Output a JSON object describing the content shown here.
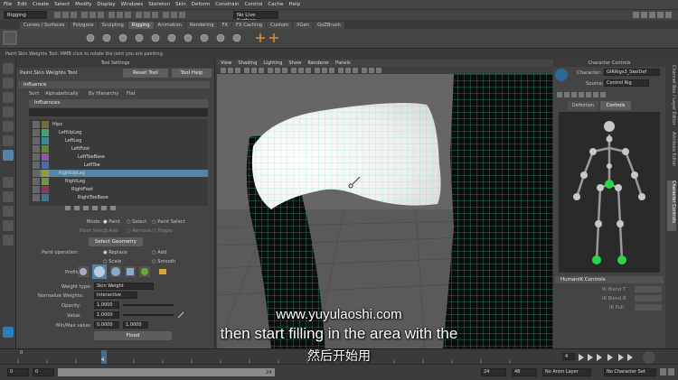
{
  "menubar": [
    "File",
    "Edit",
    "Create",
    "Select",
    "Modify",
    "Display",
    "Windows",
    "Skeleton",
    "Skin",
    "Deform",
    "Constrain",
    "Control",
    "Cache",
    "Help"
  ],
  "status": {
    "mode": "Rigging",
    "live_surface": "No Live Surface"
  },
  "shelf_tabs": [
    "Curves / Surfaces",
    "Polygons",
    "Sculpting",
    "Rigging",
    "Animation",
    "Rendering",
    "FX",
    "FX Caching",
    "Custom",
    "XGen",
    "GoZBrush"
  ],
  "shelf_active": "Rigging",
  "help_line": "Paint Skin Weights Tool: MMB click to rotate the joint you are painting.",
  "tool_settings": {
    "window_title": "Tool Settings",
    "title": "Paint Skin Weights Tool",
    "reset": "Reset Tool",
    "help": "Tool Help",
    "influence_section": "Influence",
    "sort_label": "Sort:",
    "sort_options": [
      "Alphabetically",
      "By Hierarchy",
      "Flat"
    ],
    "influences_label": "Influences",
    "joints": [
      {
        "name": "Hips",
        "color": "#7a6a3a"
      },
      {
        "name": "LeftUpLeg",
        "color": "#4aa07a"
      },
      {
        "name": "LeftLeg",
        "color": "#3a8a9a"
      },
      {
        "name": "LeftFoot",
        "color": "#5a8a3a"
      },
      {
        "name": "LeftToeBase",
        "color": "#8a5a9a"
      },
      {
        "name": "LeftToe",
        "color": "#4a6aaa"
      },
      {
        "name": "RightUpLeg",
        "color": "#9a9a3a"
      },
      {
        "name": "RightLeg",
        "color": "#6a9a4a"
      },
      {
        "name": "RightFoot",
        "color": "#8a3a5a"
      },
      {
        "name": "RightToeBase",
        "color": "#3a7a8a"
      }
    ],
    "mode_label": "Mode:",
    "mode_options": [
      "Paint",
      "Select",
      "Paint Select"
    ],
    "paint_select_label": "Paint Select:",
    "paint_select_options": [
      "Add",
      "Remove",
      "Toggle"
    ],
    "select_geometry": "Select Geometry",
    "paint_operation_label": "Paint operation:",
    "paint_operations": [
      "Replace",
      "Add",
      "Scale",
      "Smooth"
    ],
    "profile_label": "Profile:",
    "weight_type_label": "Weight type:",
    "weight_type": "Skin Weight",
    "normalize_label": "Normalize Weights:",
    "normalize": "Interactive",
    "opacity_label": "Opacity:",
    "opacity": "1.0000",
    "value_label": "Value:",
    "value": "1.0000",
    "minmax_label": "Min/Max value:",
    "min": "0.0000",
    "max": "1.0000",
    "flood": "Flood"
  },
  "viewport_menu": [
    "View",
    "Shading",
    "Lighting",
    "Show",
    "Renderer",
    "Panels"
  ],
  "character_controls": {
    "title": "Character Controls",
    "character_label": "Character:",
    "character": "GIRRigs3_SkelDef",
    "source_label": "Source:",
    "source": "Control Rig",
    "tabs": [
      "Definition",
      "Controls"
    ],
    "humanik_section": "HumanIK Controls",
    "props": [
      "IK Blend T",
      "IK Blend R",
      "IK Pull"
    ]
  },
  "right_strip": [
    "Channel Box / Layer Editor",
    "Attribute Editor",
    "Character Controls"
  ],
  "timeline": {
    "start": "0",
    "tick_4": "4",
    "current": "4"
  },
  "range": {
    "start": "0",
    "inner_start": "0",
    "inner_end_marker": "24",
    "inner_end": "24",
    "end": "48",
    "anim_layer": "No Anim Layer",
    "char_set": "No Character Set"
  },
  "subtitles": {
    "url": "www.yuyulaoshi.com",
    "english": "then start filling in the area with the",
    "chinese": "然后开始用"
  },
  "colors": {
    "wire": "#2fd7a0",
    "selection": "#5285a6",
    "active_tab": "#5d5d5d",
    "joint_green": "#2bd54a"
  }
}
